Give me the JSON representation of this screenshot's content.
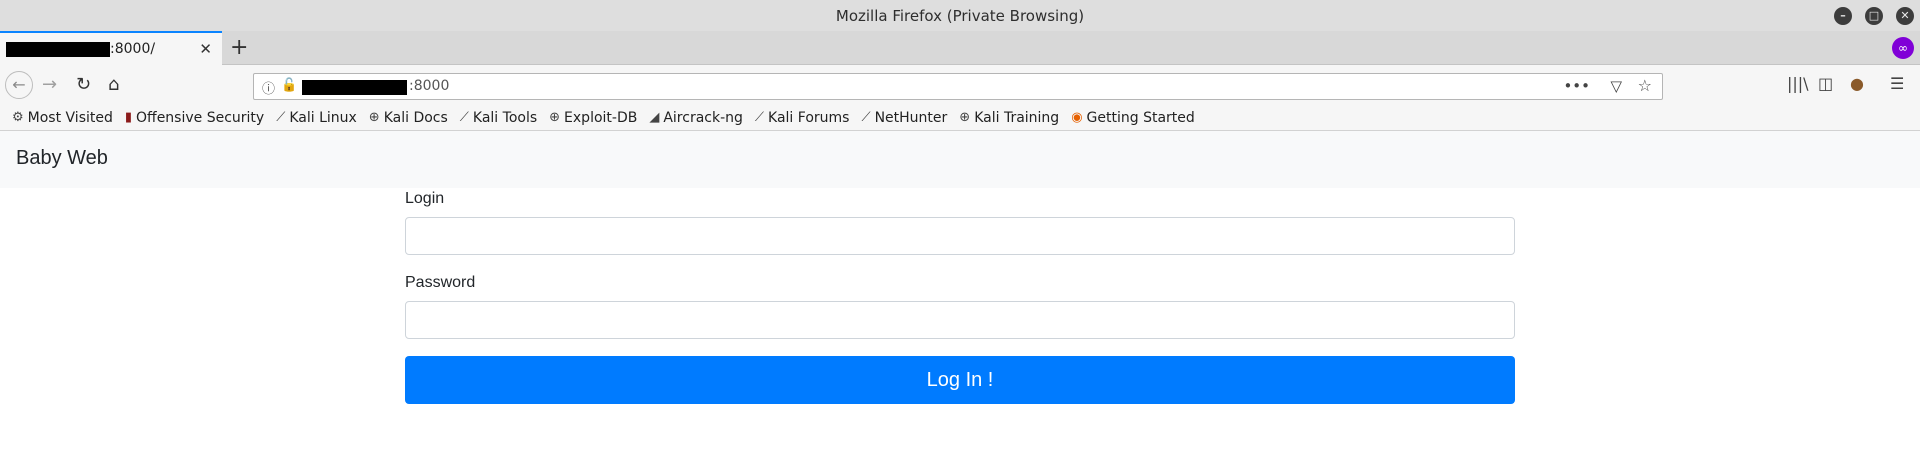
{
  "window": {
    "title": "Mozilla Firefox (Private Browsing)",
    "controls": [
      "minimize",
      "maximize",
      "close"
    ]
  },
  "tab": {
    "title": ":8000/",
    "close_glyph": "✕",
    "new_tab_glyph": "+"
  },
  "navbar": {
    "url": ":8000",
    "icons": [
      "back-icon",
      "forward-icon",
      "reload-icon",
      "home-icon",
      "info-icon",
      "insecure-lock-icon",
      "page-actions-icon",
      "pocket-icon",
      "star-icon",
      "library-icon",
      "sidebar-icon",
      "cookie-icon",
      "menu-icon"
    ]
  },
  "bookmarks": [
    {
      "label": "Most Visited",
      "icon": "gear-icon"
    },
    {
      "label": "Offensive Security",
      "icon": "offsec-icon"
    },
    {
      "label": "Kali Linux",
      "icon": "kali-icon"
    },
    {
      "label": "Kali Docs",
      "icon": "globe-icon"
    },
    {
      "label": "Kali Tools",
      "icon": "kali-icon"
    },
    {
      "label": "Exploit-DB",
      "icon": "globe-icon"
    },
    {
      "label": "Aircrack-ng",
      "icon": "aircrack-icon"
    },
    {
      "label": "Kali Forums",
      "icon": "kali-icon"
    },
    {
      "label": "NetHunter",
      "icon": "kali-icon"
    },
    {
      "label": "Kali Training",
      "icon": "globe-icon"
    },
    {
      "label": "Getting Started",
      "icon": "firefox-icon"
    }
  ],
  "page": {
    "brand": "Baby Web",
    "login_label": "Login",
    "login_value": "",
    "password_label": "Password",
    "password_value": "",
    "submit_label": "Log In !",
    "accent_color": "#007bff"
  }
}
